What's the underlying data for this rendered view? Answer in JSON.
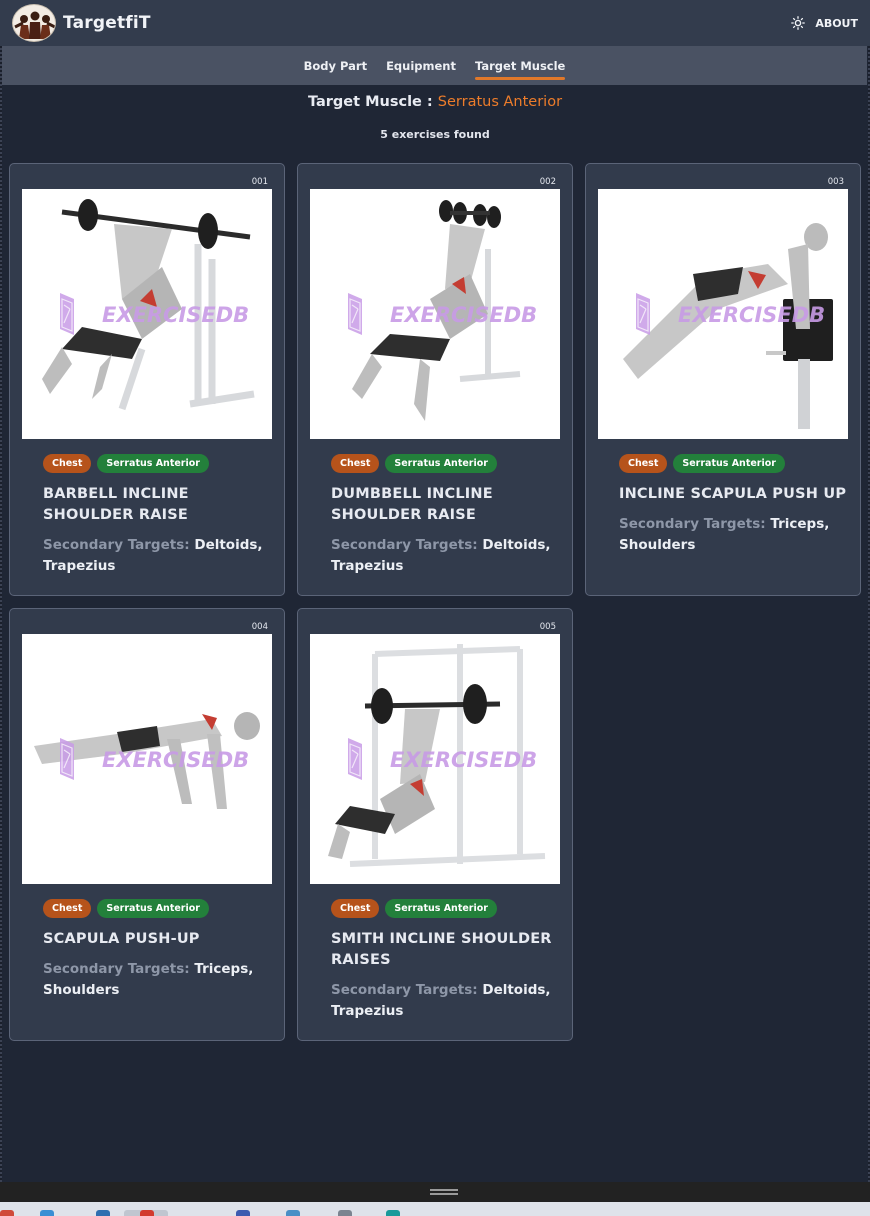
{
  "app": {
    "name": "TargetfiT",
    "about_label": "ABOUT",
    "logo_icon": "fitness-group-logo",
    "theme_icon": "sun-icon"
  },
  "nav": {
    "tabs": [
      {
        "label": "Body Part",
        "active": false
      },
      {
        "label": "Equipment",
        "active": false
      },
      {
        "label": "Target Muscle",
        "active": true
      }
    ]
  },
  "page": {
    "heading_prefix": "Target Muscle : ",
    "heading_value": "Serratus Anterior",
    "count_text": "5 exercises found"
  },
  "colors": {
    "accent": "#ec7c2b",
    "body_badge": "#b6531b",
    "target_badge": "#23803b",
    "background": "#1f2635",
    "card": "#323b4c"
  },
  "watermark_text": "EXERCISEDB",
  "secondary_label": "Secondary Targets:",
  "exercises": [
    {
      "id": "001",
      "body_part": "Chest",
      "target": "Serratus Anterior",
      "title": "BARBELL INCLINE SHOULDER RAISE",
      "secondary": "Deltoids, Trapezius",
      "image": "barbell-incline-illustration"
    },
    {
      "id": "002",
      "body_part": "Chest",
      "target": "Serratus Anterior",
      "title": "DUMBBELL INCLINE SHOULDER RAISE",
      "secondary": "Deltoids, Trapezius",
      "image": "dumbbell-incline-illustration"
    },
    {
      "id": "003",
      "body_part": "Chest",
      "target": "Serratus Anterior",
      "title": "INCLINE SCAPULA PUSH UP",
      "secondary": "Triceps, Shoulders",
      "image": "incline-pushup-illustration"
    },
    {
      "id": "004",
      "body_part": "Chest",
      "target": "Serratus Anterior",
      "title": "SCAPULA PUSH-UP",
      "secondary": "Triceps, Shoulders",
      "image": "scapula-pushup-illustration"
    },
    {
      "id": "005",
      "body_part": "Chest",
      "target": "Serratus Anterior",
      "title": "SMITH INCLINE SHOULDER RAISES",
      "secondary": "Deltoids, Trapezius",
      "image": "smith-incline-illustration"
    }
  ]
}
